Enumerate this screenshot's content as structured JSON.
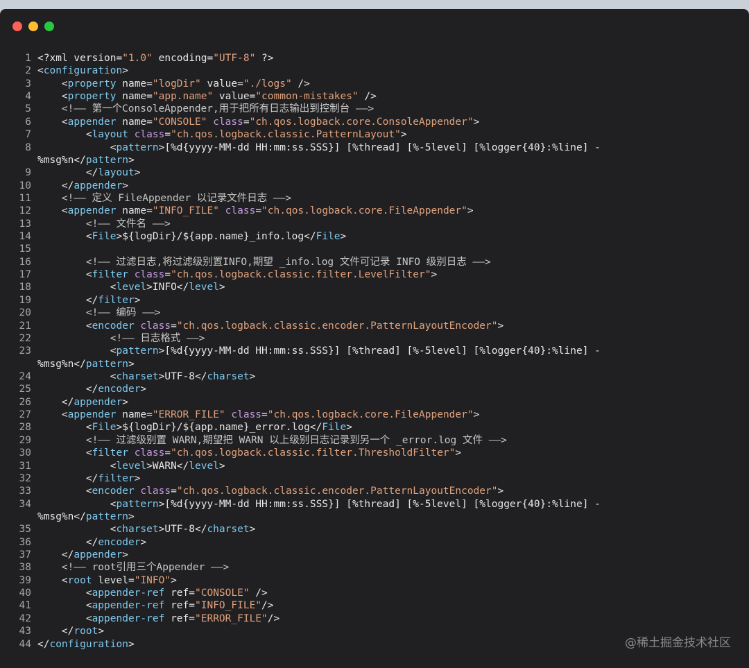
{
  "window": {
    "controls": [
      {
        "name": "close",
        "color": "#fe5f57"
      },
      {
        "name": "minimize",
        "color": "#febc2e"
      },
      {
        "name": "zoom",
        "color": "#28c840"
      }
    ]
  },
  "colors": {
    "background": "#202022",
    "tag": "#7fc9ee",
    "attribute": "#c49adf",
    "string": "#e0a27d",
    "comment": "#c8c8c8",
    "text": "#e6e6e6"
  },
  "code_lines": [
    {
      "n": "1",
      "segs": [
        [
          "p",
          "<?xml version="
        ],
        [
          "s",
          "\"1.0\""
        ],
        [
          "p",
          " encoding="
        ],
        [
          "s",
          "\"UTF-8\""
        ],
        [
          "p",
          " ?>"
        ]
      ]
    },
    {
      "n": "2",
      "segs": [
        [
          "p",
          "<"
        ],
        [
          "t",
          "configuration"
        ],
        [
          "p",
          ">"
        ]
      ]
    },
    {
      "n": "3",
      "segs": [
        [
          "p",
          "    <"
        ],
        [
          "t",
          "property"
        ],
        [
          "p",
          " name="
        ],
        [
          "s",
          "\"logDir\""
        ],
        [
          "p",
          " value="
        ],
        [
          "s",
          "\"./logs\""
        ],
        [
          "p",
          " />"
        ]
      ]
    },
    {
      "n": "4",
      "segs": [
        [
          "p",
          "    <"
        ],
        [
          "t",
          "property"
        ],
        [
          "p",
          " name="
        ],
        [
          "s",
          "\"app.name\""
        ],
        [
          "p",
          " value="
        ],
        [
          "s",
          "\"common-mistakes\""
        ],
        [
          "p",
          " />"
        ]
      ]
    },
    {
      "n": "5",
      "segs": [
        [
          "c",
          "    <!—— 第一个ConsoleAppender,用于把所有日志输出到控制台 ——>"
        ]
      ]
    },
    {
      "n": "6",
      "segs": [
        [
          "p",
          "    <"
        ],
        [
          "t",
          "appender"
        ],
        [
          "p",
          " name="
        ],
        [
          "s",
          "\"CONSOLE\""
        ],
        [
          "a",
          " class"
        ],
        [
          "p",
          "="
        ],
        [
          "s",
          "\"ch.qos.logback.core.ConsoleAppender\""
        ],
        [
          "p",
          ">"
        ]
      ]
    },
    {
      "n": "7",
      "segs": [
        [
          "p",
          "        <"
        ],
        [
          "t",
          "layout"
        ],
        [
          "a",
          " class"
        ],
        [
          "p",
          "="
        ],
        [
          "s",
          "\"ch.qos.logback.classic.PatternLayout\""
        ],
        [
          "p",
          ">"
        ]
      ]
    },
    {
      "n": "8",
      "segs": [
        [
          "p",
          "            <"
        ],
        [
          "t",
          "pattern"
        ],
        [
          "p",
          ">[%d{yyyy-MM-dd HH:mm:ss.SSS}] [%thread] [%-5level] [%logger{40}:%line] -"
        ]
      ]
    },
    {
      "n": "",
      "segs": [
        [
          "p",
          "%msg%n</"
        ],
        [
          "t",
          "pattern"
        ],
        [
          "p",
          ">"
        ]
      ]
    },
    {
      "n": "9",
      "segs": [
        [
          "p",
          "        </"
        ],
        [
          "t",
          "layout"
        ],
        [
          "p",
          ">"
        ]
      ]
    },
    {
      "n": "10",
      "segs": [
        [
          "p",
          "    </"
        ],
        [
          "t",
          "appender"
        ],
        [
          "p",
          ">"
        ]
      ]
    },
    {
      "n": "11",
      "segs": [
        [
          "c",
          "    <!—— 定义 FileAppender 以记录文件日志 ——>"
        ]
      ]
    },
    {
      "n": "12",
      "segs": [
        [
          "p",
          "    <"
        ],
        [
          "t",
          "appender"
        ],
        [
          "p",
          " name="
        ],
        [
          "s",
          "\"INFO_FILE\""
        ],
        [
          "a",
          " class"
        ],
        [
          "p",
          "="
        ],
        [
          "s",
          "\"ch.qos.logback.core.FileAppender\""
        ],
        [
          "p",
          ">"
        ]
      ]
    },
    {
      "n": "13",
      "segs": [
        [
          "c",
          "        <!—— 文件名 ——>"
        ]
      ]
    },
    {
      "n": "14",
      "segs": [
        [
          "p",
          "        <"
        ],
        [
          "t",
          "File"
        ],
        [
          "p",
          ">${logDir}/${app.name}_info.log</"
        ],
        [
          "t",
          "File"
        ],
        [
          "p",
          ">"
        ]
      ]
    },
    {
      "n": "15",
      "segs": [
        [
          "p",
          ""
        ]
      ]
    },
    {
      "n": "16",
      "segs": [
        [
          "c",
          "        <!—— 过滤日志,将过滤级别置INFO,期望 _info.log 文件可记录 INFO 级别日志 ——>"
        ]
      ]
    },
    {
      "n": "17",
      "segs": [
        [
          "p",
          "        <"
        ],
        [
          "t",
          "filter"
        ],
        [
          "a",
          " class"
        ],
        [
          "p",
          "="
        ],
        [
          "s",
          "\"ch.qos.logback.classic.filter.LevelFilter\""
        ],
        [
          "p",
          ">"
        ]
      ]
    },
    {
      "n": "18",
      "segs": [
        [
          "p",
          "            <"
        ],
        [
          "t",
          "level"
        ],
        [
          "p",
          ">INFO</"
        ],
        [
          "t",
          "level"
        ],
        [
          "p",
          ">"
        ]
      ]
    },
    {
      "n": "19",
      "segs": [
        [
          "p",
          "        </"
        ],
        [
          "t",
          "filter"
        ],
        [
          "p",
          ">"
        ]
      ]
    },
    {
      "n": "20",
      "segs": [
        [
          "c",
          "        <!—— 编码 ——>"
        ]
      ]
    },
    {
      "n": "21",
      "segs": [
        [
          "p",
          "        <"
        ],
        [
          "t",
          "encoder"
        ],
        [
          "a",
          " class"
        ],
        [
          "p",
          "="
        ],
        [
          "s",
          "\"ch.qos.logback.classic.encoder.PatternLayoutEncoder\""
        ],
        [
          "p",
          ">"
        ]
      ]
    },
    {
      "n": "22",
      "segs": [
        [
          "c",
          "            <!—— 日志格式 ——>"
        ]
      ]
    },
    {
      "n": "23",
      "segs": [
        [
          "p",
          "            <"
        ],
        [
          "t",
          "pattern"
        ],
        [
          "p",
          ">[%d{yyyy-MM-dd HH:mm:ss.SSS}] [%thread] [%-5level] [%logger{40}:%line] -"
        ]
      ]
    },
    {
      "n": "",
      "segs": [
        [
          "p",
          "%msg%n</"
        ],
        [
          "t",
          "pattern"
        ],
        [
          "p",
          ">"
        ]
      ]
    },
    {
      "n": "24",
      "segs": [
        [
          "p",
          "            <"
        ],
        [
          "t",
          "charset"
        ],
        [
          "p",
          ">UTF-8</"
        ],
        [
          "t",
          "charset"
        ],
        [
          "p",
          ">"
        ]
      ]
    },
    {
      "n": "25",
      "segs": [
        [
          "p",
          "        </"
        ],
        [
          "t",
          "encoder"
        ],
        [
          "p",
          ">"
        ]
      ]
    },
    {
      "n": "26",
      "segs": [
        [
          "p",
          "    </"
        ],
        [
          "t",
          "appender"
        ],
        [
          "p",
          ">"
        ]
      ]
    },
    {
      "n": "27",
      "segs": [
        [
          "p",
          "    <"
        ],
        [
          "t",
          "appender"
        ],
        [
          "p",
          " name="
        ],
        [
          "s",
          "\"ERROR_FILE\""
        ],
        [
          "a",
          " class"
        ],
        [
          "p",
          "="
        ],
        [
          "s",
          "\"ch.qos.logback.core.FileAppender\""
        ],
        [
          "p",
          ">"
        ]
      ]
    },
    {
      "n": "28",
      "segs": [
        [
          "p",
          "        <"
        ],
        [
          "t",
          "File"
        ],
        [
          "p",
          ">${logDir}/${app.name}_error.log</"
        ],
        [
          "t",
          "File"
        ],
        [
          "p",
          ">"
        ]
      ]
    },
    {
      "n": "29",
      "segs": [
        [
          "c",
          "        <!—— 过滤级别置 WARN,期望把 WARN 以上级别日志记录到另一个 _error.log 文件 ——>"
        ]
      ]
    },
    {
      "n": "30",
      "segs": [
        [
          "p",
          "        <"
        ],
        [
          "t",
          "filter"
        ],
        [
          "a",
          " class"
        ],
        [
          "p",
          "="
        ],
        [
          "s",
          "\"ch.qos.logback.classic.filter.ThresholdFilter\""
        ],
        [
          "p",
          ">"
        ]
      ]
    },
    {
      "n": "31",
      "segs": [
        [
          "p",
          "            <"
        ],
        [
          "t",
          "level"
        ],
        [
          "p",
          ">WARN</"
        ],
        [
          "t",
          "level"
        ],
        [
          "p",
          ">"
        ]
      ]
    },
    {
      "n": "32",
      "segs": [
        [
          "p",
          "        </"
        ],
        [
          "t",
          "filter"
        ],
        [
          "p",
          ">"
        ]
      ]
    },
    {
      "n": "33",
      "segs": [
        [
          "p",
          "        <"
        ],
        [
          "t",
          "encoder"
        ],
        [
          "a",
          " class"
        ],
        [
          "p",
          "="
        ],
        [
          "s",
          "\"ch.qos.logback.classic.encoder.PatternLayoutEncoder\""
        ],
        [
          "p",
          ">"
        ]
      ]
    },
    {
      "n": "34",
      "segs": [
        [
          "p",
          "            <"
        ],
        [
          "t",
          "pattern"
        ],
        [
          "p",
          ">[%d{yyyy-MM-dd HH:mm:ss.SSS}] [%thread] [%-5level] [%logger{40}:%line] -"
        ]
      ]
    },
    {
      "n": "",
      "segs": [
        [
          "p",
          "%msg%n</"
        ],
        [
          "t",
          "pattern"
        ],
        [
          "p",
          ">"
        ]
      ]
    },
    {
      "n": "35",
      "segs": [
        [
          "p",
          "            <"
        ],
        [
          "t",
          "charset"
        ],
        [
          "p",
          ">UTF-8</"
        ],
        [
          "t",
          "charset"
        ],
        [
          "p",
          ">"
        ]
      ]
    },
    {
      "n": "36",
      "segs": [
        [
          "p",
          "        </"
        ],
        [
          "t",
          "encoder"
        ],
        [
          "p",
          ">"
        ]
      ]
    },
    {
      "n": "37",
      "segs": [
        [
          "p",
          "    </"
        ],
        [
          "t",
          "appender"
        ],
        [
          "p",
          ">"
        ]
      ]
    },
    {
      "n": "38",
      "segs": [
        [
          "c",
          "    <!—— root引用三个Appender ——>"
        ]
      ]
    },
    {
      "n": "39",
      "segs": [
        [
          "p",
          "    <"
        ],
        [
          "t",
          "root"
        ],
        [
          "p",
          " level="
        ],
        [
          "s",
          "\"INFO\""
        ],
        [
          "p",
          ">"
        ]
      ]
    },
    {
      "n": "40",
      "segs": [
        [
          "p",
          "        <"
        ],
        [
          "t",
          "appender-ref"
        ],
        [
          "p",
          " ref="
        ],
        [
          "s",
          "\"CONSOLE\""
        ],
        [
          "p",
          " />"
        ]
      ]
    },
    {
      "n": "41",
      "segs": [
        [
          "p",
          "        <"
        ],
        [
          "t",
          "appender-ref"
        ],
        [
          "p",
          " ref="
        ],
        [
          "s",
          "\"INFO_FILE\""
        ],
        [
          "p",
          "/>"
        ]
      ]
    },
    {
      "n": "42",
      "segs": [
        [
          "p",
          "        <"
        ],
        [
          "t",
          "appender-ref"
        ],
        [
          "p",
          " ref="
        ],
        [
          "s",
          "\"ERROR_FILE\""
        ],
        [
          "p",
          "/>"
        ]
      ]
    },
    {
      "n": "43",
      "segs": [
        [
          "p",
          "    </"
        ],
        [
          "t",
          "root"
        ],
        [
          "p",
          ">"
        ]
      ]
    },
    {
      "n": "44",
      "segs": [
        [
          "p",
          "</"
        ],
        [
          "t",
          "configuration"
        ],
        [
          "p",
          ">"
        ]
      ]
    }
  ],
  "watermark": "@稀土掘金技术社区"
}
